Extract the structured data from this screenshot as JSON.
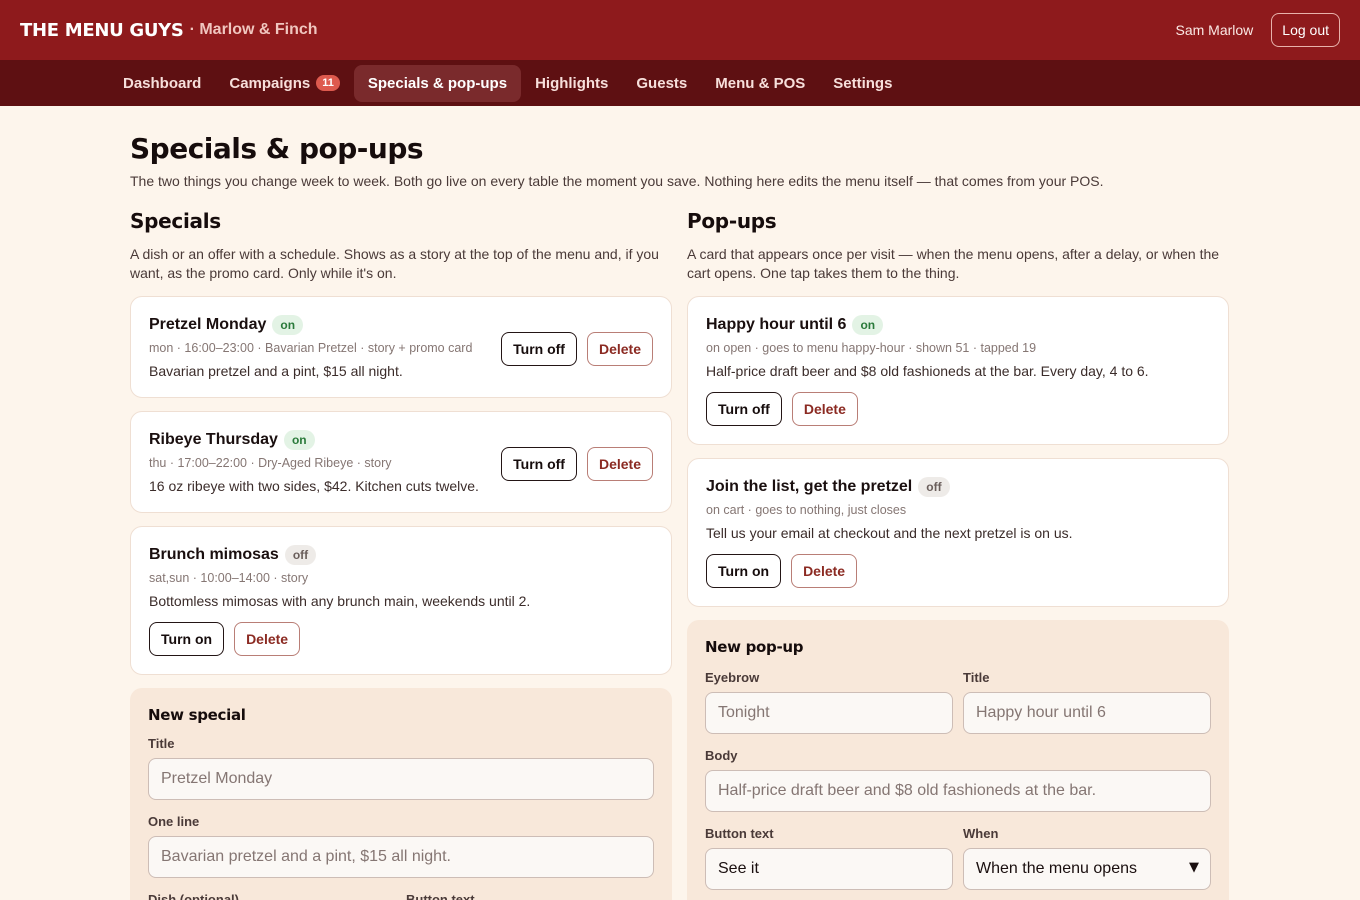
{
  "header": {
    "brand": "THE MENU GUYS",
    "subtitle": "· Marlow & Finch",
    "user": "Sam Marlow",
    "logout_label": "Log out"
  },
  "nav": {
    "items": [
      {
        "label": "Dashboard"
      },
      {
        "label": "Campaigns",
        "badge": "11"
      },
      {
        "label": "Specials & pop-ups"
      },
      {
        "label": "Highlights"
      },
      {
        "label": "Guests"
      },
      {
        "label": "Menu & POS"
      },
      {
        "label": "Settings"
      }
    ],
    "active": "Specials & pop-ups"
  },
  "page": {
    "title": "Specials & pop-ups",
    "description": "The two things you change week to week. Both go live on every table the moment you save. Nothing here edits the menu itself — that comes from your POS."
  },
  "specials": {
    "title": "Specials",
    "description": "A dish or an offer with a schedule. Shows as a story at the top of the menu and, if you want, as the promo card. Only while it's on.",
    "items": [
      {
        "title": "Pretzel Monday",
        "status": "on",
        "meta": "mon · 16:00–23:00 · Bavarian Pretzel · story + promo card",
        "body": "Bavarian pretzel and a pint, $15 all night.",
        "toggle_label": "Turn off",
        "delete_label": "Delete"
      },
      {
        "title": "Ribeye Thursday",
        "status": "on",
        "meta": "thu · 17:00–22:00 · Dry-Aged Ribeye · story",
        "body": "16 oz ribeye with two sides, $42. Kitchen cuts twelve.",
        "toggle_label": "Turn off",
        "delete_label": "Delete"
      },
      {
        "title": "Brunch mimosas",
        "status": "off",
        "meta": "sat,sun · 10:00–14:00 · story",
        "body": "Bottomless mimosas with any brunch main, weekends until 2.",
        "toggle_label": "Turn on",
        "delete_label": "Delete"
      }
    ],
    "form": {
      "title": "New special",
      "title_label": "Title",
      "title_placeholder": "Pretzel Monday",
      "oneline_label": "One line",
      "oneline_placeholder": "Bavarian pretzel and a pint, $15 all night.",
      "dish_label": "Dish (optional)",
      "button_label": "Button text"
    }
  },
  "popups": {
    "title": "Pop-ups",
    "description": "A card that appears once per visit — when the menu opens, after a delay, or when the cart opens. One tap takes them to the thing.",
    "items": [
      {
        "title": "Happy hour until 6",
        "status": "on",
        "meta": "on open · goes to menu happy-hour · shown 51 · tapped 19",
        "body": "Half-price draft beer and $8 old fashioneds at the bar. Every day, 4 to 6.",
        "toggle_label": "Turn off",
        "delete_label": "Delete"
      },
      {
        "title": "Join the list, get the pretzel",
        "status": "off",
        "meta": "on cart · goes to nothing, just closes",
        "body": "Tell us your email at checkout and the next pretzel is on us.",
        "toggle_label": "Turn on",
        "delete_label": "Delete"
      }
    ],
    "form": {
      "title": "New pop-up",
      "eyebrow_label": "Eyebrow",
      "eyebrow_placeholder": "Tonight",
      "title_label": "Title",
      "title_placeholder": "Happy hour until 6",
      "body_label": "Body",
      "body_placeholder": "Half-price draft beer and $8 old fashioneds at the bar.",
      "button_label": "Button text",
      "button_value": "See it",
      "when_label": "When",
      "when_value": "When the menu opens"
    }
  }
}
